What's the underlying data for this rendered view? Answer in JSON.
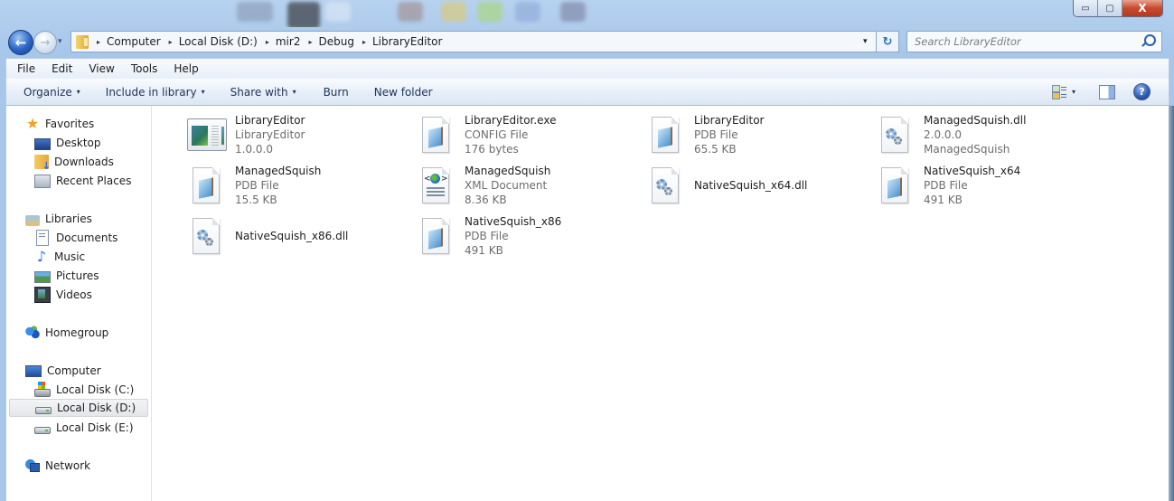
{
  "window": {
    "caption_buttons": {
      "minimize": "▭",
      "maximize": "▢",
      "close": "X"
    }
  },
  "nav": {
    "back_icon": "←",
    "forward_icon": "→",
    "recent_dropdown_icon": "▾",
    "breadcrumb": [
      "Computer",
      "Local Disk (D:)",
      "mir2",
      "Debug",
      "LibraryEditor"
    ],
    "breadcrumb_separator": "▸",
    "address_dropdown_icon": "▾",
    "refresh_icon": "↻",
    "search_placeholder": "Search LibraryEditor"
  },
  "menu": [
    "File",
    "Edit",
    "View",
    "Tools",
    "Help"
  ],
  "commands": {
    "organize": "Organize",
    "include_in_library": "Include in library",
    "share_with": "Share with",
    "burn": "Burn",
    "new_folder": "New folder",
    "caret": "▾",
    "help_icon": "?"
  },
  "sidebar": {
    "favorites": {
      "label": "Favorites",
      "items": [
        "Desktop",
        "Downloads",
        "Recent Places"
      ]
    },
    "libraries": {
      "label": "Libraries",
      "items": [
        "Documents",
        "Music",
        "Pictures",
        "Videos"
      ]
    },
    "homegroup": {
      "label": "Homegroup"
    },
    "computer": {
      "label": "Computer",
      "items": [
        "Local Disk (C:)",
        "Local Disk (D:)",
        "Local Disk (E:)"
      ],
      "selected": "Local Disk (D:)"
    },
    "network": {
      "label": "Network"
    },
    "star_icon": "★",
    "music_icon": "♪"
  },
  "files": [
    {
      "name": "LibraryEditor",
      "line2": "LibraryEditor",
      "line3": "1.0.0.0",
      "icon": "application-icon"
    },
    {
      "name": "LibraryEditor.exe",
      "line2": "CONFIG File",
      "line3": "176 bytes",
      "icon": "config-file-icon"
    },
    {
      "name": "LibraryEditor",
      "line2": "PDB File",
      "line3": "65.5 KB",
      "icon": "pdb-file-icon"
    },
    {
      "name": "ManagedSquish.dll",
      "line2": "2.0.0.0",
      "line3": "ManagedSquish",
      "icon": "dll-gears-icon"
    },
    {
      "name": "ManagedSquish",
      "line2": "PDB File",
      "line3": "15.5 KB",
      "icon": "pdb-file-icon"
    },
    {
      "name": "ManagedSquish",
      "line2": "XML Document",
      "line3": "8.36 KB",
      "icon": "xml-document-icon"
    },
    {
      "name": "NativeSquish_x64.dll",
      "icon": "dll-gears-icon"
    },
    {
      "name": "NativeSquish_x64",
      "line2": "PDB File",
      "line3": "491 KB",
      "icon": "pdb-file-icon"
    },
    {
      "name": "NativeSquish_x86.dll",
      "icon": "dll-gears-icon"
    },
    {
      "name": "NativeSquish_x86",
      "line2": "PDB File",
      "line3": "491 KB",
      "icon": "pdb-file-icon"
    }
  ]
}
